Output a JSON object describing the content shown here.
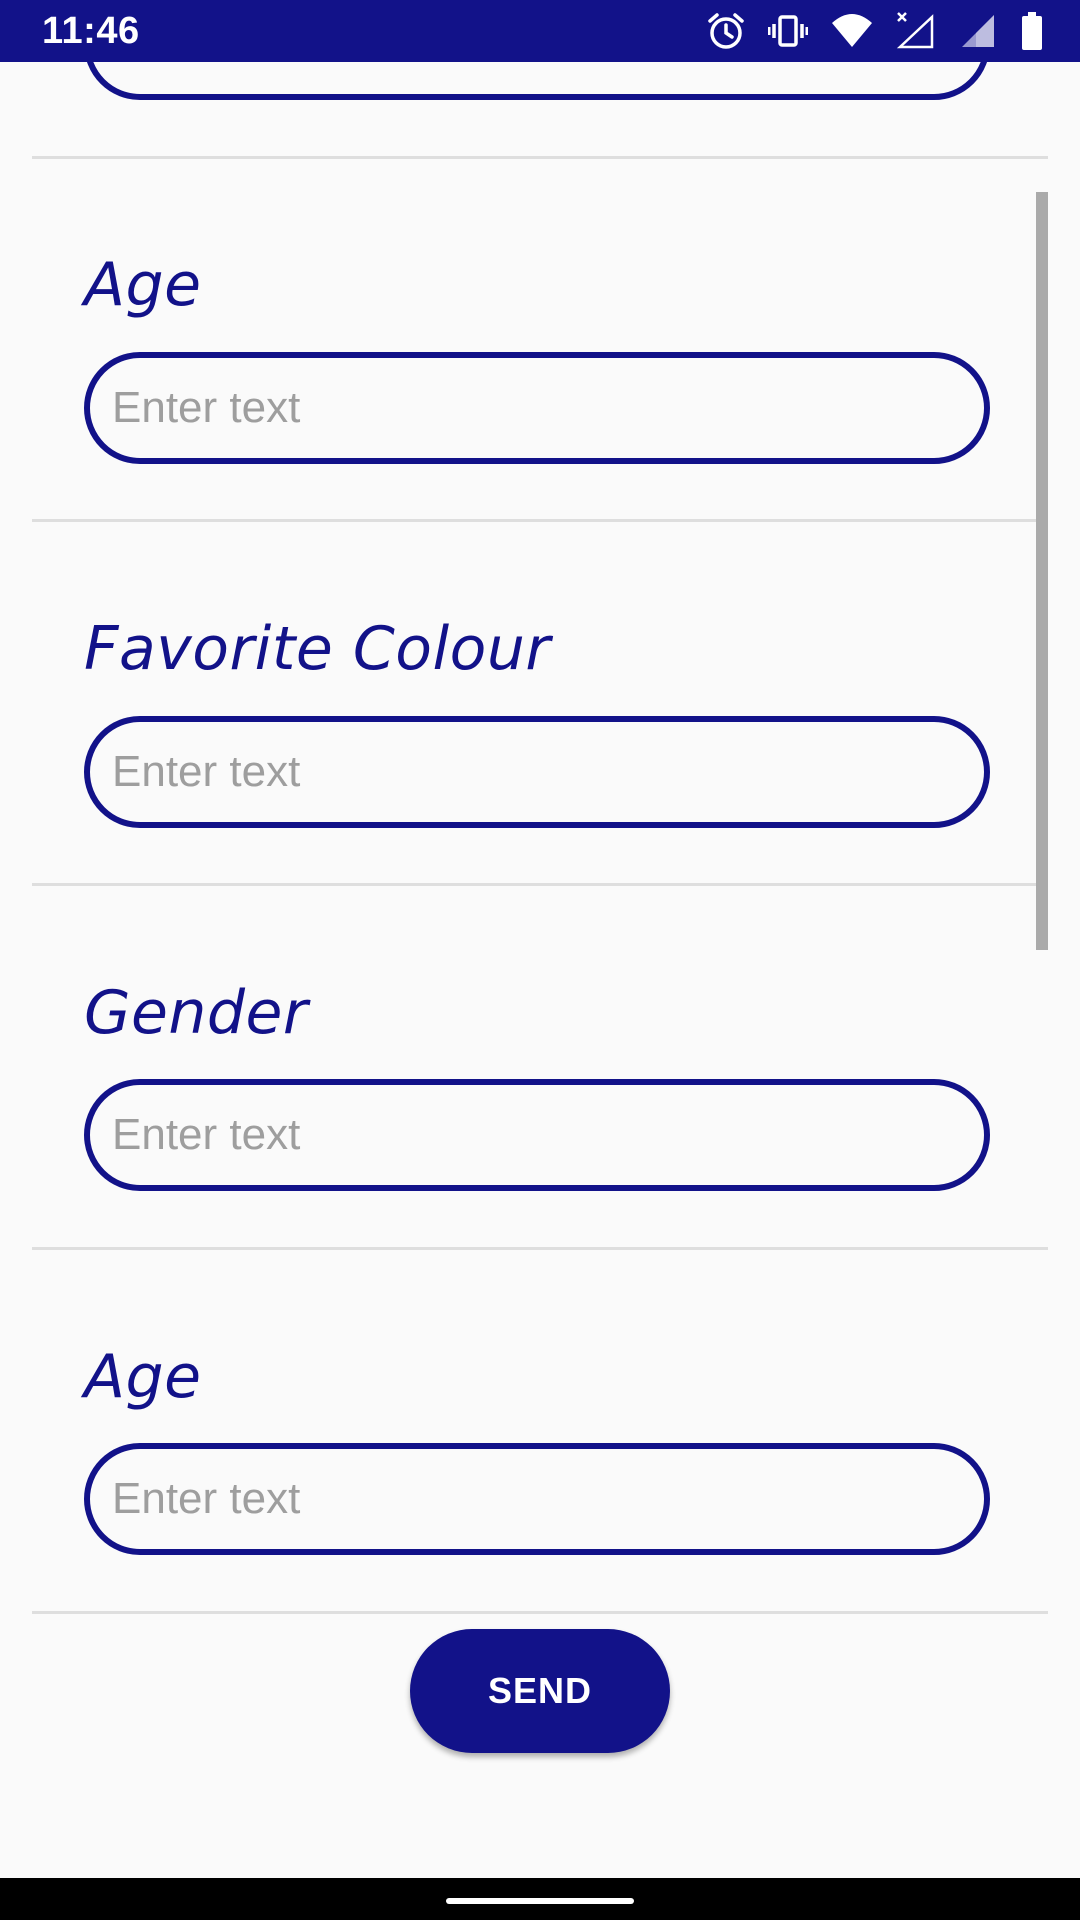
{
  "status_bar": {
    "time": "11:46",
    "icons": [
      "alarm-icon",
      "vibrate-icon",
      "wifi-icon",
      "no-signal-icon",
      "cell-signal-icon",
      "battery-icon"
    ]
  },
  "form": {
    "fields": [
      {
        "label": "",
        "placeholder": "Enter text"
      },
      {
        "label": "Age",
        "placeholder": "Enter text"
      },
      {
        "label": "Favorite Colour",
        "placeholder": "Enter text"
      },
      {
        "label": "Gender",
        "placeholder": "Enter text"
      },
      {
        "label": "Age",
        "placeholder": "Enter text"
      }
    ]
  },
  "send_button": {
    "label": "SEND"
  },
  "colors": {
    "accent": "#121289",
    "background": "#fafafa",
    "divider": "#dedede",
    "placeholder": "#9e9e9e"
  }
}
